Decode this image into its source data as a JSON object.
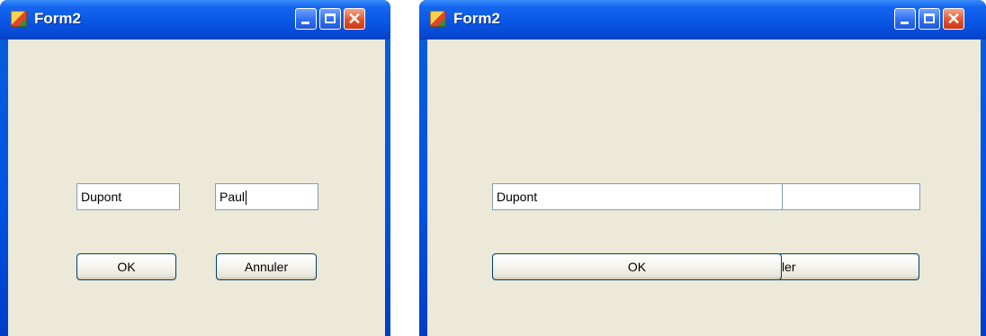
{
  "left_window": {
    "title": "Form2",
    "last_name_value": "Dupont",
    "first_name_value": "Paul",
    "ok_label": "OK",
    "cancel_label": "Annuler"
  },
  "right_window": {
    "title": "Form2",
    "last_name_value": "Dupont",
    "ok_label": "OK",
    "cancel_fragment": "ler"
  },
  "colors": {
    "titlebar_blue": "#0a57e6",
    "client_background": "#ece9d8",
    "close_button_red": "#e2542f"
  }
}
